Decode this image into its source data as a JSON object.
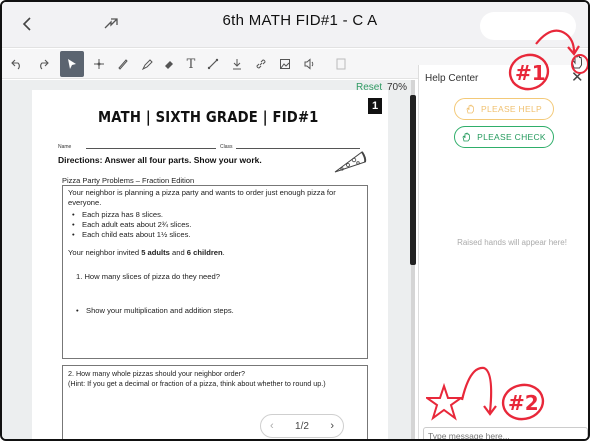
{
  "window": {
    "title": "6th MATH FID#1 - C A"
  },
  "topbar": {
    "back_icon": "chevron-left-icon",
    "share_icon": "share-arrow-icon"
  },
  "toolbar": {
    "tools": [
      "undo-icon",
      "redo-icon",
      "select-pointer-icon",
      "move-icon",
      "pen-icon",
      "highlighter-icon",
      "eraser-icon",
      "text-icon",
      "line-icon",
      "download-icon",
      "link-icon",
      "image-icon",
      "audio-icon",
      "page-icon"
    ],
    "active_tool": "select-pointer-icon"
  },
  "viewer": {
    "reset_label": "Reset",
    "zoom": "70%",
    "page_badge": "1"
  },
  "worksheet": {
    "title": "MATH | SIXTH GRADE | FID#1",
    "name_label": "Name",
    "class_label": "Class",
    "directions": "Directions: Answer all four parts. Show your work.",
    "subtitle": "Pizza Party Problems – Fraction Edition",
    "intro": "Your neighbor is planning a pizza party and wants to order just enough pizza for everyone.",
    "bullets": [
      "Each pizza has 8 slices.",
      "Each adult eats about 2¾ slices.",
      "Each child eats about 1½ slices."
    ],
    "invited_prefix": "Your neighbor invited ",
    "invited_adults": "5 adults",
    "invited_mid": " and ",
    "invited_children": "6 children",
    "invited_suffix": ".",
    "q1": "1. How many slices of pizza do they need?",
    "q1_bullet": "Show your multiplication and addition steps.",
    "q2_line1": "2. How many whole pizzas should your neighbor order?",
    "q2_line2": "(Hint: If you get a decimal or fraction of a pizza, think about whether to round up.)"
  },
  "pager": {
    "prev": "‹",
    "label": "1/2",
    "next": "›"
  },
  "help_center": {
    "title": "Help Center",
    "close": "✕",
    "please_help": "PLEASE HELP",
    "please_check": "PLEASE CHECK",
    "empty_state": "Raised hands will appear here!",
    "message_placeholder": "Type message here..."
  },
  "annotations": {
    "mark1": "#1",
    "mark2": "#2"
  },
  "colors": {
    "accent_green": "#2fae6a",
    "help_yellow": "#f3c978",
    "annotation_red": "#e8283a"
  }
}
